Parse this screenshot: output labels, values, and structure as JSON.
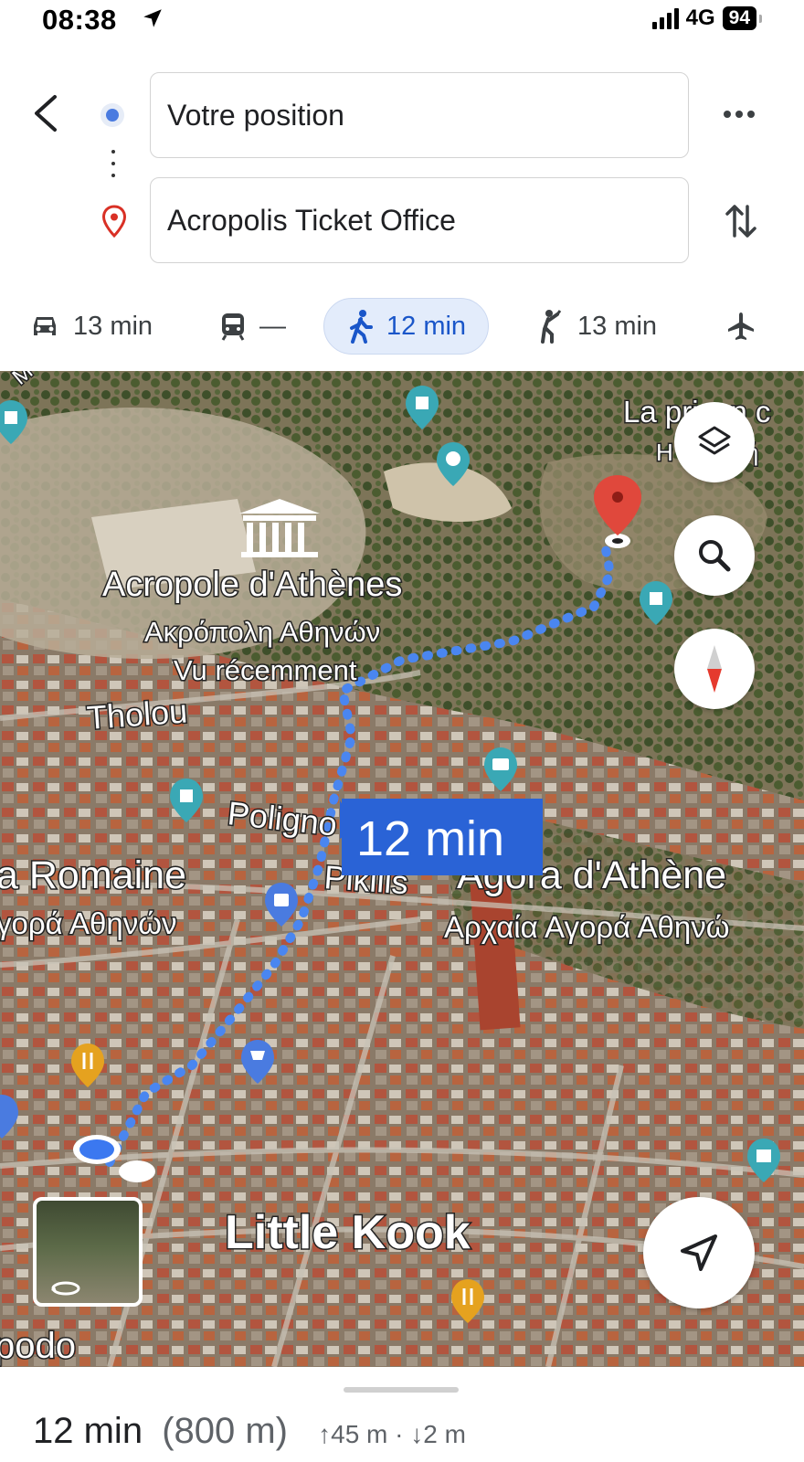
{
  "status_bar": {
    "time": "08:38",
    "network": "4G",
    "battery": "94"
  },
  "directions": {
    "origin": "Votre position",
    "destination": "Acropolis Ticket Office"
  },
  "modes": [
    {
      "name": "car",
      "icon": "car-icon",
      "label": "13 min",
      "active": false
    },
    {
      "name": "transit",
      "icon": "train-icon",
      "label": "—",
      "active": false
    },
    {
      "name": "walk",
      "icon": "walk-icon",
      "label": "12 min",
      "active": true
    },
    {
      "name": "ride",
      "icon": "ride-icon",
      "label": "13 min",
      "active": false
    },
    {
      "name": "flight",
      "icon": "plane-icon",
      "label": "",
      "active": false
    }
  ],
  "map": {
    "route_label": "12 min",
    "labels": {
      "acropolis": "Acropole d'Athènes",
      "acropolis_gr": "Ακρόπολη Αθηνών",
      "recently_viewed": "Vu récemment",
      "tholou": "Tholou",
      "poligno": "Poligno",
      "pikilis": "Pikilis",
      "romaine": "a Romaine",
      "romaine_gr": "γορά Αθηνών",
      "agora": "Agora d'Athène",
      "agora_gr": "Αρχαία Αγορά Αθηνώ",
      "little_kook": "Little Kook",
      "prison": "La prison c",
      "prison_gr": "Η φυλακή",
      "street_top": "M",
      "bottom_left": "podo"
    }
  },
  "bottom_sheet": {
    "duration": "12 min",
    "distance": "(800 m)",
    "elevation": "↑45 m · ↓2 m"
  },
  "colors": {
    "accent": "#1a56c9",
    "route": "#4a86f0",
    "pin": "#e0483c",
    "label_bg": "#2a63d6"
  }
}
